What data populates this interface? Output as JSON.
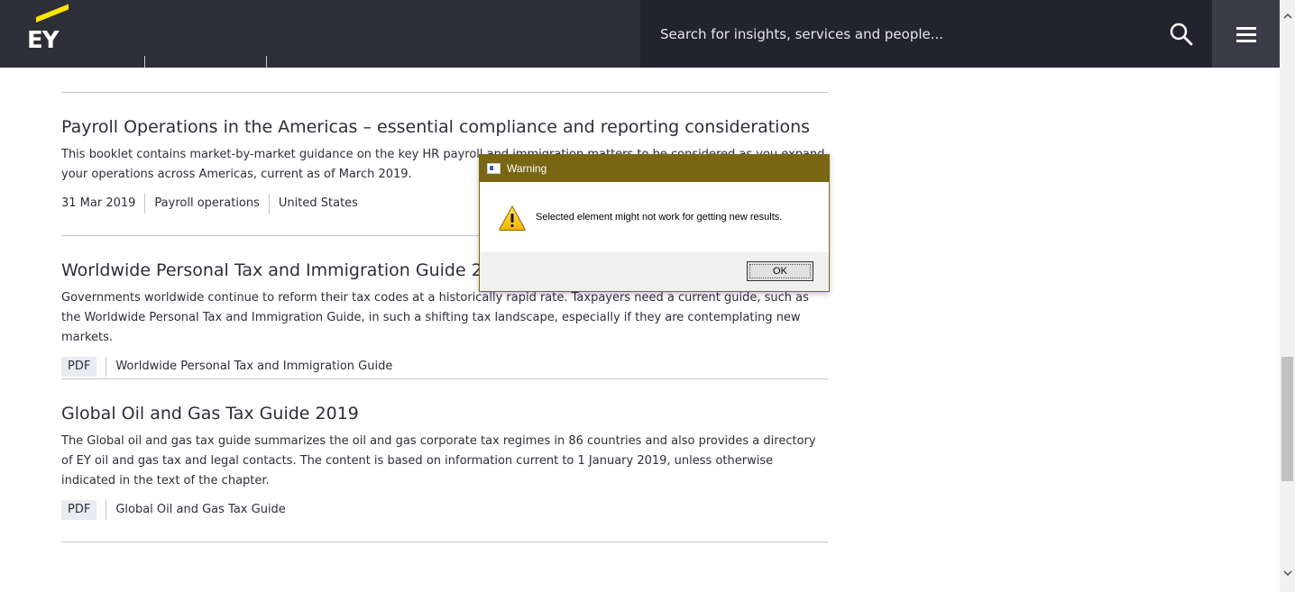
{
  "header": {
    "logo_text": "EY",
    "search_placeholder": "Search for insights, services and people...",
    "search_icon": "search-icon",
    "menu_icon": "hamburger-menu-icon",
    "colors": {
      "bar": "#2e2e38",
      "search_bg": "#23232f",
      "brand_yellow": "#ffe600"
    }
  },
  "articles": [
    {
      "title": "Payroll Operations in the Americas – essential compliance and reporting considerations",
      "description": "This booklet contains market-by-market guidance on the key HR payroll and immigration matters to be considered as you expand your operations across Americas, current as of March 2019.",
      "meta": [
        "31 Mar 2019",
        "Payroll operations",
        "United States"
      ]
    },
    {
      "title": "Worldwide Personal Tax and Immigration Guide 2019",
      "description": "Governments worldwide continue to reform their tax codes at a historically rapid rate. Taxpayers need a current guide, such as the Worldwide Personal Tax and Immigration Guide, in such a shifting tax landscape, especially if they are contemplating new markets.",
      "badge": "PDF",
      "meta": [
        "Worldwide Personal Tax and Immigration Guide"
      ]
    },
    {
      "title": "Global Oil and Gas Tax Guide 2019",
      "description": "The Global oil and gas tax guide summarizes the oil and gas corporate tax regimes in 86 countries and also provides a directory of EY oil and gas tax and legal contacts. The content is based on information current to 1 January 2019, unless otherwise indicated in the text of the chapter.",
      "badge": "PDF",
      "meta": [
        "Global Oil and Gas Tax Guide"
      ]
    }
  ],
  "dialog": {
    "title": "Warning",
    "message": "Selected element might not work for getting new results.",
    "ok_label": "OK",
    "icon": "warning-icon",
    "titlebar_color": "#786612"
  }
}
